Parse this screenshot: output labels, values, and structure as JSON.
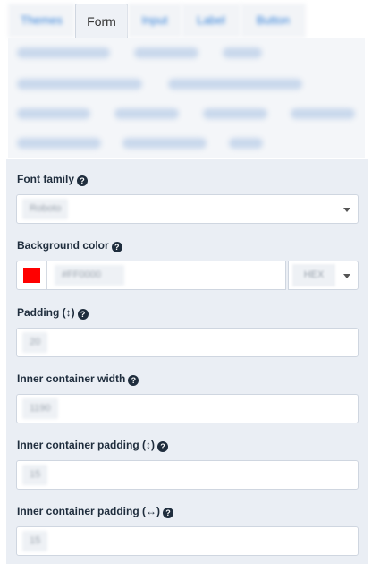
{
  "tabs": [
    {
      "label": "Themes",
      "active": false
    },
    {
      "label": "Form",
      "active": true
    },
    {
      "label": "Input",
      "active": false
    },
    {
      "label": "Label",
      "active": false
    },
    {
      "label": "Button",
      "active": false
    }
  ],
  "fields": {
    "font_family": {
      "label": "Font family",
      "value": "Roboto"
    },
    "background_color": {
      "label": "Background color",
      "value": "#FF0000",
      "format": "HEX",
      "swatch": "#ff0000"
    },
    "padding": {
      "label": "Padding (↕)",
      "value": "20"
    },
    "inner_width": {
      "label": "Inner container width",
      "value": "1190"
    },
    "inner_padding_v": {
      "label": "Inner container padding (↕)",
      "value": "15"
    },
    "inner_padding_h": {
      "label": "Inner container padding (↔)",
      "value": "15"
    }
  },
  "help_glyph": "?"
}
